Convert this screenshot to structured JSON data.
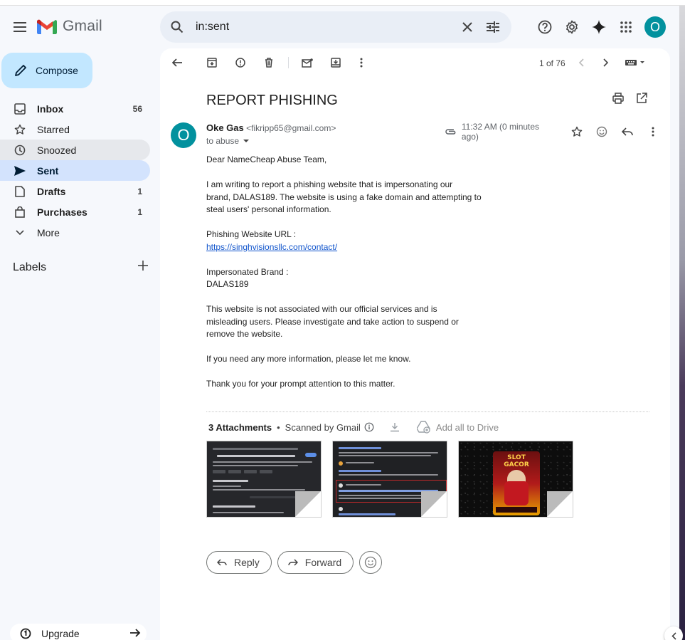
{
  "app": {
    "name": "Gmail"
  },
  "search": {
    "query": "in:sent"
  },
  "account": {
    "initial": "O"
  },
  "compose": {
    "label": "Compose"
  },
  "nav": [
    {
      "label": "Inbox",
      "count": "56",
      "icon": "inbox-icon"
    },
    {
      "label": "Starred",
      "count": "",
      "icon": "star-icon"
    },
    {
      "label": "Snoozed",
      "count": "",
      "icon": "clock-icon"
    },
    {
      "label": "Sent",
      "count": "",
      "icon": "send-icon"
    },
    {
      "label": "Drafts",
      "count": "1",
      "icon": "draft-icon"
    },
    {
      "label": "Purchases",
      "count": "1",
      "icon": "purchases-icon"
    },
    {
      "label": "More",
      "count": "",
      "icon": "chevron-down-icon"
    }
  ],
  "labels": {
    "title": "Labels"
  },
  "upgrade": {
    "label": "Upgrade"
  },
  "pager": {
    "text": "1 of 76"
  },
  "email": {
    "subject": "REPORT PHISHING",
    "sender_initial": "O",
    "sender_name": "Oke Gas",
    "sender_email": "<fikripp65@gmail.com>",
    "to": "to abuse",
    "time": "11:32 AM (0 minutes ago)",
    "body": {
      "greeting": "Dear NameCheap Abuse Team,",
      "p1_l1": "I am writing to report a phishing website that is impersonating our",
      "p1_l2": "brand, DALAS189. The website is using a fake domain and attempting to",
      "p1_l3": "steal users' personal information.",
      "url_label": "Phishing Website URL :",
      "url": "https://singhvisionsllc.com/contact/",
      "brand_label": "Impersonated Brand :",
      "brand": "DALAS189",
      "p3_l1": "This website is not associated with our official services and is",
      "p3_l2": "misleading users. Please investigate and take action to suspend or",
      "p3_l3": "remove the website.",
      "p4": "If you need any more information, please let me know.",
      "p5": "Thank you for your prompt attention to this matter."
    },
    "attachments": {
      "title": "3 Attachments",
      "scanned": "Scanned by Gmail",
      "add_all": "Add all to Drive",
      "thumb3_text": "SLOT GACOR"
    }
  },
  "actions": {
    "reply": "Reply",
    "forward": "Forward"
  },
  "colors": {
    "accent": "#0b57d0",
    "avatar": "#02919e",
    "compose_bg": "#c2e7ff",
    "active_nav": "#d3e3fd"
  }
}
